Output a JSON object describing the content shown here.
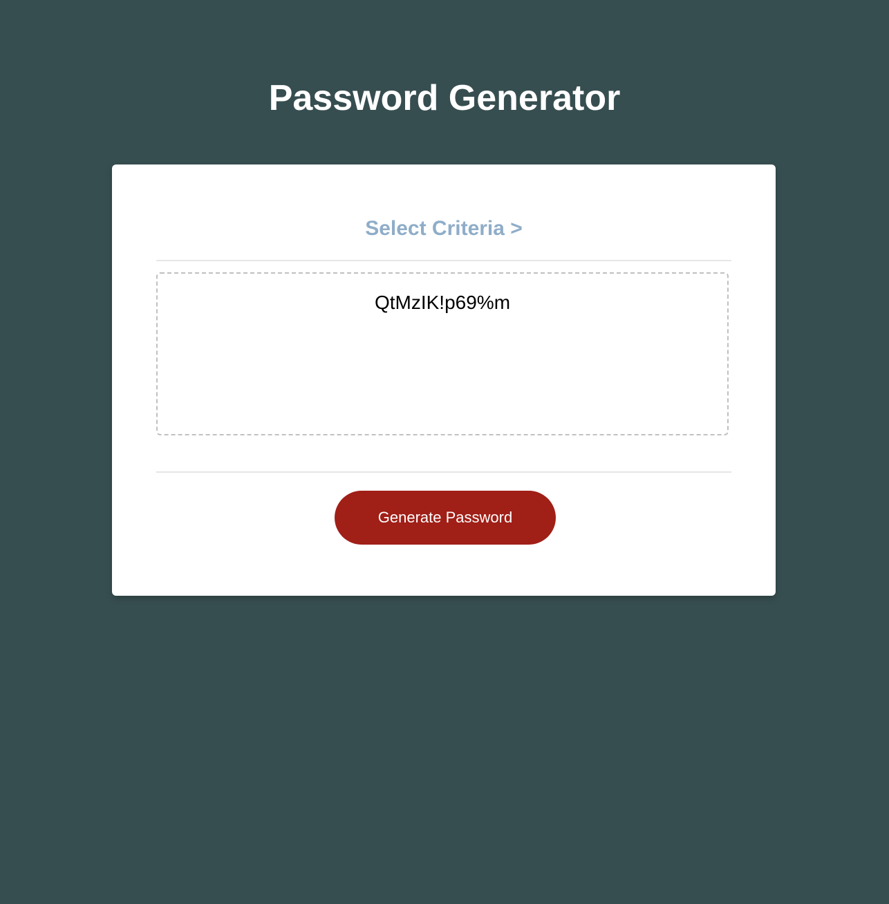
{
  "header": {
    "title": "Password Generator"
  },
  "card": {
    "heading": "Select Criteria >",
    "password": "QtMzIK!p69%m",
    "generate_label": "Generate Password"
  },
  "colors": {
    "background": "#374e50",
    "accent": "#8fadc8",
    "button": "#a01f17"
  }
}
